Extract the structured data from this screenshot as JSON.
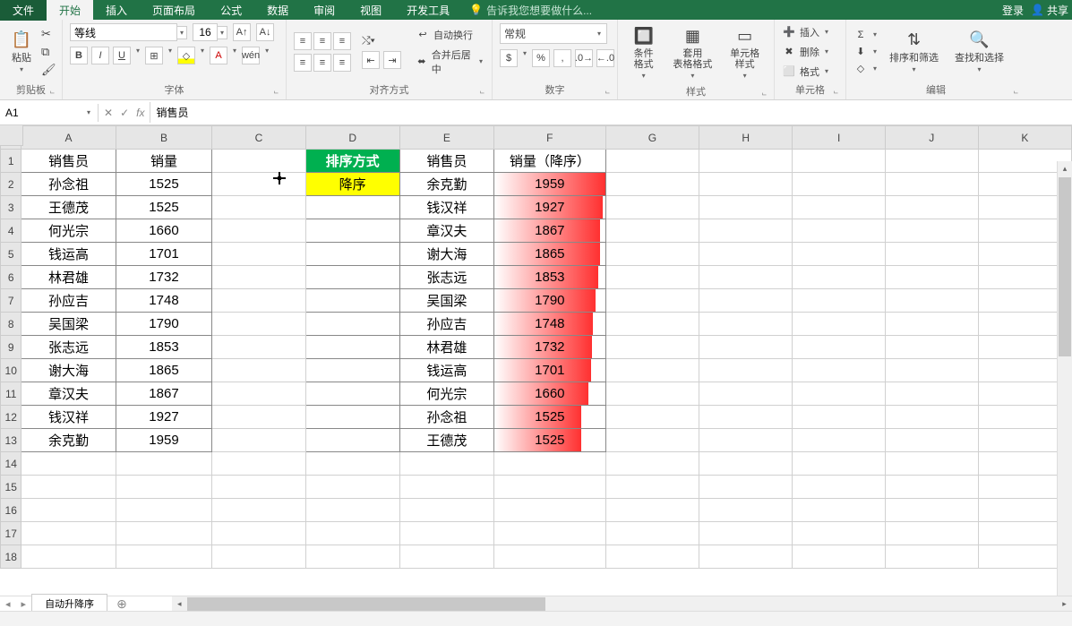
{
  "titlebar": {
    "file": "文件",
    "tabs": [
      "开始",
      "插入",
      "页面布局",
      "公式",
      "数据",
      "审阅",
      "视图",
      "开发工具"
    ],
    "active": 0,
    "tell": "告诉我您想要做什么...",
    "login": "登录",
    "share": "共享"
  },
  "ribbon": {
    "clipboard": {
      "paste": "粘贴",
      "name": "剪贴板"
    },
    "font": {
      "name": "字体",
      "family": "等线",
      "size": "16"
    },
    "align": {
      "name": "对齐方式",
      "wrap": "自动换行",
      "merge": "合并后居中"
    },
    "number": {
      "name": "数字",
      "format": "常规"
    },
    "styles": {
      "name": "样式",
      "cf": "条件格式",
      "tbl": "套用\n表格格式",
      "cell": "单元格样式"
    },
    "cells": {
      "name": "单元格",
      "ins": "插入",
      "del": "删除",
      "fmt": "格式"
    },
    "edit": {
      "name": "编辑",
      "sort": "排序和筛选",
      "find": "查找和选择"
    }
  },
  "formula_bar": {
    "cell": "A1",
    "value": "销售员"
  },
  "columns": [
    "A",
    "B",
    "C",
    "D",
    "E",
    "F",
    "G",
    "H",
    "I",
    "J",
    "K"
  ],
  "rows": [
    "1",
    "2",
    "3",
    "4",
    "5",
    "6",
    "7",
    "8",
    "9",
    "10",
    "11",
    "12",
    "13",
    "14",
    "15",
    "16",
    "17",
    "18"
  ],
  "headers": {
    "a": "销售员",
    "b": "销量",
    "d": "排序方式",
    "e": "销售员",
    "f": "销量（降序）"
  },
  "d2": "降序",
  "dataAB": [
    {
      "name": "孙念祖",
      "val": "1525"
    },
    {
      "name": "王德茂",
      "val": "1525"
    },
    {
      "name": "何光宗",
      "val": "1660"
    },
    {
      "name": "钱运高",
      "val": "1701"
    },
    {
      "name": "林君雄",
      "val": "1732"
    },
    {
      "name": "孙应吉",
      "val": "1748"
    },
    {
      "name": "吴国梁",
      "val": "1790"
    },
    {
      "name": "张志远",
      "val": "1853"
    },
    {
      "name": "谢大海",
      "val": "1865"
    },
    {
      "name": "章汉夫",
      "val": "1867"
    },
    {
      "name": "钱汉祥",
      "val": "1927"
    },
    {
      "name": "余克勤",
      "val": "1959"
    }
  ],
  "dataEF": [
    {
      "name": "余克勤",
      "val": "1959",
      "bar": 100
    },
    {
      "name": "钱汉祥",
      "val": "1927",
      "bar": 98
    },
    {
      "name": "章汉夫",
      "val": "1867",
      "bar": 95
    },
    {
      "name": "谢大海",
      "val": "1865",
      "bar": 95
    },
    {
      "name": "张志远",
      "val": "1853",
      "bar": 94
    },
    {
      "name": "吴国梁",
      "val": "1790",
      "bar": 91
    },
    {
      "name": "孙应吉",
      "val": "1748",
      "bar": 89
    },
    {
      "name": "林君雄",
      "val": "1732",
      "bar": 88
    },
    {
      "name": "钱运高",
      "val": "1701",
      "bar": 87
    },
    {
      "name": "何光宗",
      "val": "1660",
      "bar": 85
    },
    {
      "name": "孙念祖",
      "val": "1525",
      "bar": 78
    },
    {
      "name": "王德茂",
      "val": "1525",
      "bar": 78
    }
  ],
  "sheet": "自动升降序",
  "status": ""
}
